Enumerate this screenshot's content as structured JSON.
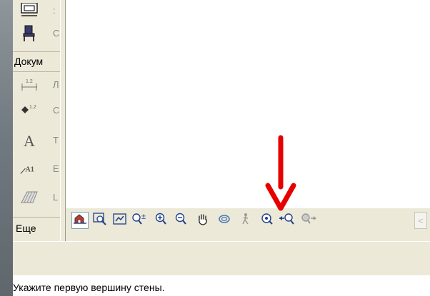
{
  "palette": {
    "section_document": "Докум",
    "more_label": "Еще",
    "tools": [
      {
        "icon": "window-icon",
        "label_fragment": ":"
      },
      {
        "icon": "chair-icon",
        "label_fragment": "С"
      },
      {
        "icon": "linear-dimension-icon",
        "label_fragment": "Л"
      },
      {
        "icon": "level-dimension-icon",
        "label_fragment": "С"
      },
      {
        "icon": "text-tool-icon",
        "label_fragment": "Т"
      },
      {
        "icon": "label-tool-icon",
        "label_fragment": "Е"
      },
      {
        "icon": "hatch-fill-icon",
        "label_fragment": "L"
      }
    ]
  },
  "nav_toolbar": {
    "buttons": [
      "3d-view-icon",
      "zoom-window-icon",
      "fit-to-window-icon",
      "zoom-in-out-icon",
      "zoom-in-icon",
      "zoom-out-icon",
      "pan-hand-icon",
      "orbit-icon",
      "walk-icon",
      "zoom-extents-icon",
      "previous-view-icon",
      "next-view-icon"
    ],
    "scroll_glyph": "<"
  },
  "annotation": {
    "color": "#e60000"
  },
  "status_bar": {
    "text": "Укажите первую вершину стены."
  }
}
